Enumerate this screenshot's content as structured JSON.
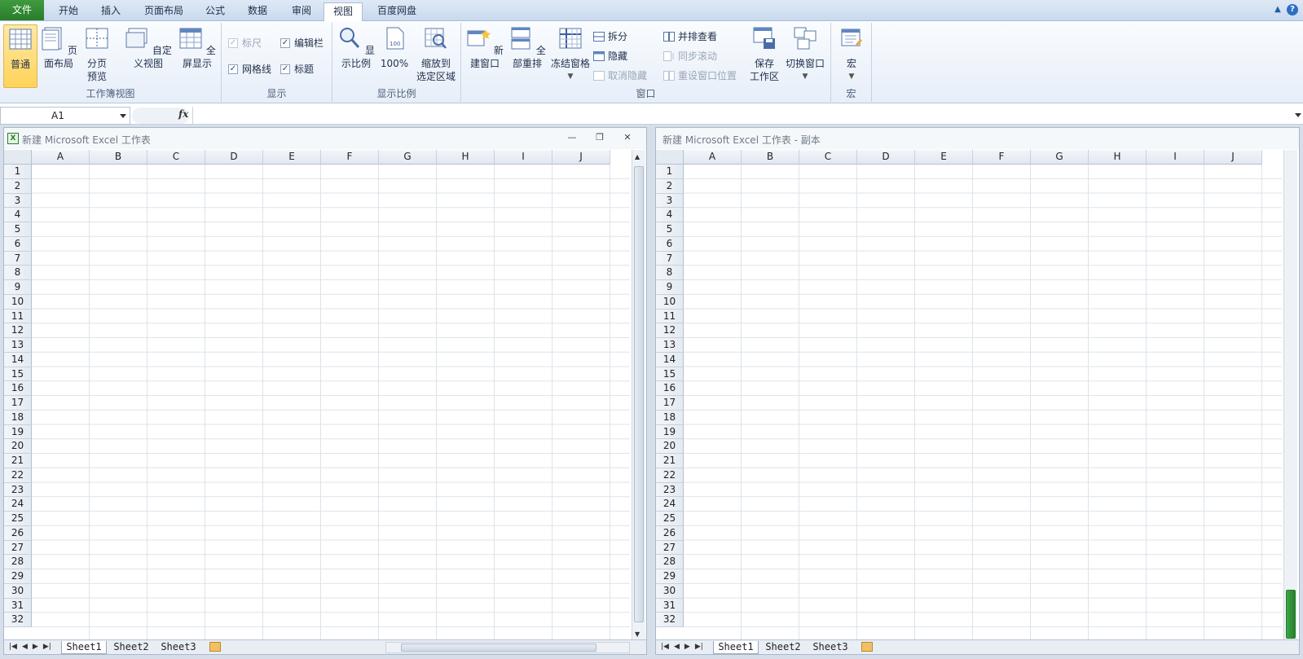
{
  "tabs": {
    "file": "文件",
    "items": [
      "开始",
      "插入",
      "页面布局",
      "公式",
      "数据",
      "审阅",
      "视图",
      "百度网盘"
    ],
    "active_index": 6
  },
  "ribbon": {
    "workbook_views": {
      "label": "工作簿视图",
      "normal": "普通",
      "page_layout": "页面布局",
      "page_break_1": "分页",
      "page_break_2": "预览",
      "custom_views": "自定义视图",
      "full_screen": "全屏显示"
    },
    "show": {
      "label": "显示",
      "ruler": "标尺",
      "formula_bar": "编辑栏",
      "gridlines": "网格线",
      "headings": "标题"
    },
    "zoom": {
      "label": "显示比例",
      "zoom": "显示比例",
      "hundred": "100%",
      "zoom_sel_1": "缩放到",
      "zoom_sel_2": "选定区域"
    },
    "window": {
      "label": "窗口",
      "new_window": "新建窗口",
      "arrange_all": "全部重排",
      "freeze_panes": "冻结窗格",
      "split": "拆分",
      "hide": "隐藏",
      "unhide": "取消隐藏",
      "side_by_side": "并排查看",
      "sync_scroll": "同步滚动",
      "reset_position": "重设窗口位置",
      "save_ws_1": "保存",
      "save_ws_2": "工作区",
      "switch_windows": "切换窗口"
    },
    "macros": {
      "label": "宏",
      "macros": "宏"
    }
  },
  "formula_bar": {
    "name_box": "A1",
    "fx": "fx",
    "value": ""
  },
  "windows": [
    {
      "title": "新建 Microsoft Excel 工作表",
      "sheets": [
        "Sheet1",
        "Sheet2",
        "Sheet3"
      ],
      "active_sheet": 0
    },
    {
      "title": "新建 Microsoft Excel 工作表 - 副本",
      "sheets": [
        "Sheet1",
        "Sheet2",
        "Sheet3"
      ],
      "active_sheet": 0
    }
  ],
  "columns": [
    "A",
    "B",
    "C",
    "D",
    "E",
    "F",
    "G",
    "H",
    "I",
    "J"
  ],
  "rows": [
    "1",
    "2",
    "3",
    "4",
    "5",
    "6",
    "7",
    "8",
    "9",
    "10",
    "11",
    "12",
    "13",
    "14",
    "15",
    "16",
    "17",
    "18",
    "19",
    "20",
    "21",
    "22",
    "23",
    "24",
    "25",
    "26",
    "27",
    "28",
    "29",
    "30",
    "31",
    "32"
  ],
  "colors": {
    "file_tab": "#2a7d2a",
    "selected_button": "#ffd35a",
    "ribbon_bg": "#e6eef8"
  }
}
